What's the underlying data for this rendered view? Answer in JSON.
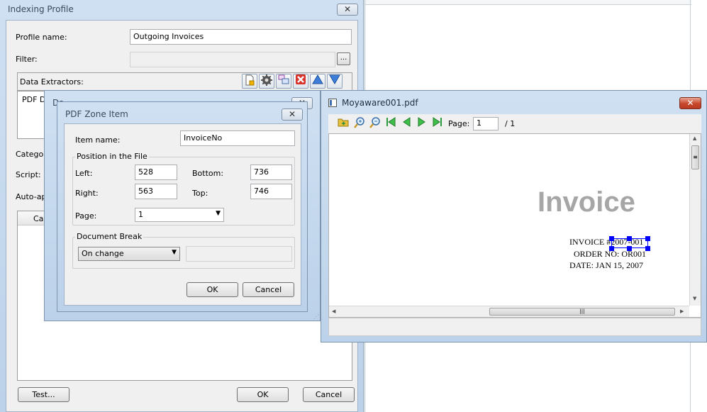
{
  "indexing_profile": {
    "title": "Indexing Profile",
    "close_glyph": "✕",
    "profile_name_label": "Profile name:",
    "profile_name_value": "Outgoing Invoices",
    "filter_label": "Filter:",
    "filter_value": "",
    "browse_label": "...",
    "data_extractors_label": "Data Extractors:",
    "list_item_visible": "PDF Da",
    "category_label": "Categor",
    "script_label": "Script:",
    "auto_label": "Auto-ap",
    "column_header": "Ca",
    "test_button": "Test...",
    "ok_button": "OK",
    "cancel_button": "Cancel",
    "toolbar_icons": [
      "new-extractor-icon",
      "settings-gear-icon",
      "copy-icon",
      "delete-icon",
      "move-up-icon",
      "move-down-icon"
    ]
  },
  "pdf_data_dialog": {
    "title": "PDF Da",
    "title_tail": "Da",
    "close_glyph": "✕"
  },
  "zone_dialog": {
    "title": "PDF Zone Item",
    "close_glyph": "✕",
    "item_name_label": "Item name:",
    "item_name_value": "InvoiceNo",
    "position_group": "Position in the File",
    "left_label": "Left:",
    "left_value": "528",
    "bottom_label": "Bottom:",
    "bottom_value": "736",
    "right_label": "Right:",
    "right_value": "563",
    "top_label": "Top:",
    "top_value": "746",
    "page_label": "Page:",
    "page_value": "1",
    "document_break_group": "Document Break",
    "document_break_value": "On change",
    "document_break_text": "",
    "ok_button": "OK",
    "cancel_button": "Cancel"
  },
  "viewer": {
    "title": "Moyaware001.pdf",
    "close_glyph": "✕",
    "page_label": "Page:",
    "page_value": "1",
    "page_total": "/ 1",
    "doc_heading": "Invoice",
    "doc_lines": [
      "INVOICE #2007-001",
      "ORDER NO: OR001",
      "DATE: JAN 15, 2007"
    ],
    "hscroll_grip": "|||",
    "vscroll_grip": "≡"
  },
  "colors": {
    "selection_handle": "#0000ff",
    "invoice_heading": "#a6a6a6",
    "delete_red": "#d9342b",
    "arrow_blue": "#3d7fd8"
  }
}
